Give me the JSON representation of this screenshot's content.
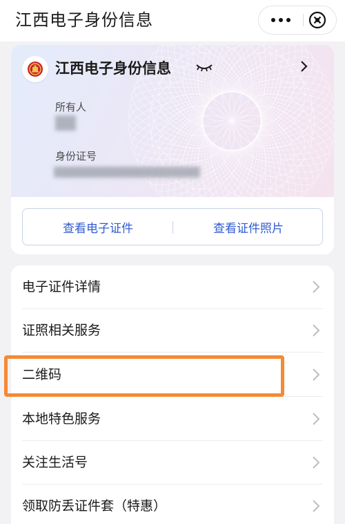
{
  "header": {
    "title": "江西电子身份信息",
    "more_icon": "more-dots-icon",
    "close_icon": "close-circle-icon"
  },
  "card": {
    "emblem_icon": "national-emblem-icon",
    "title": "江西电子身份信息",
    "visibility_icon": "eye-closed-icon",
    "owner_label": "所有人",
    "id_label": "身份证号",
    "view_card_button": "查看电子证件",
    "view_photo_button": "查看证件照片",
    "accent_color": "#2f5bd2"
  },
  "menu": {
    "items": [
      {
        "label": "电子证件详情"
      },
      {
        "label": "证照相关服务"
      },
      {
        "label": "二维码"
      },
      {
        "label": "本地特色服务"
      },
      {
        "label": "关注生活号"
      },
      {
        "label": "领取防丢证件套（特惠）"
      }
    ],
    "highlight_color": "#f58a33"
  }
}
